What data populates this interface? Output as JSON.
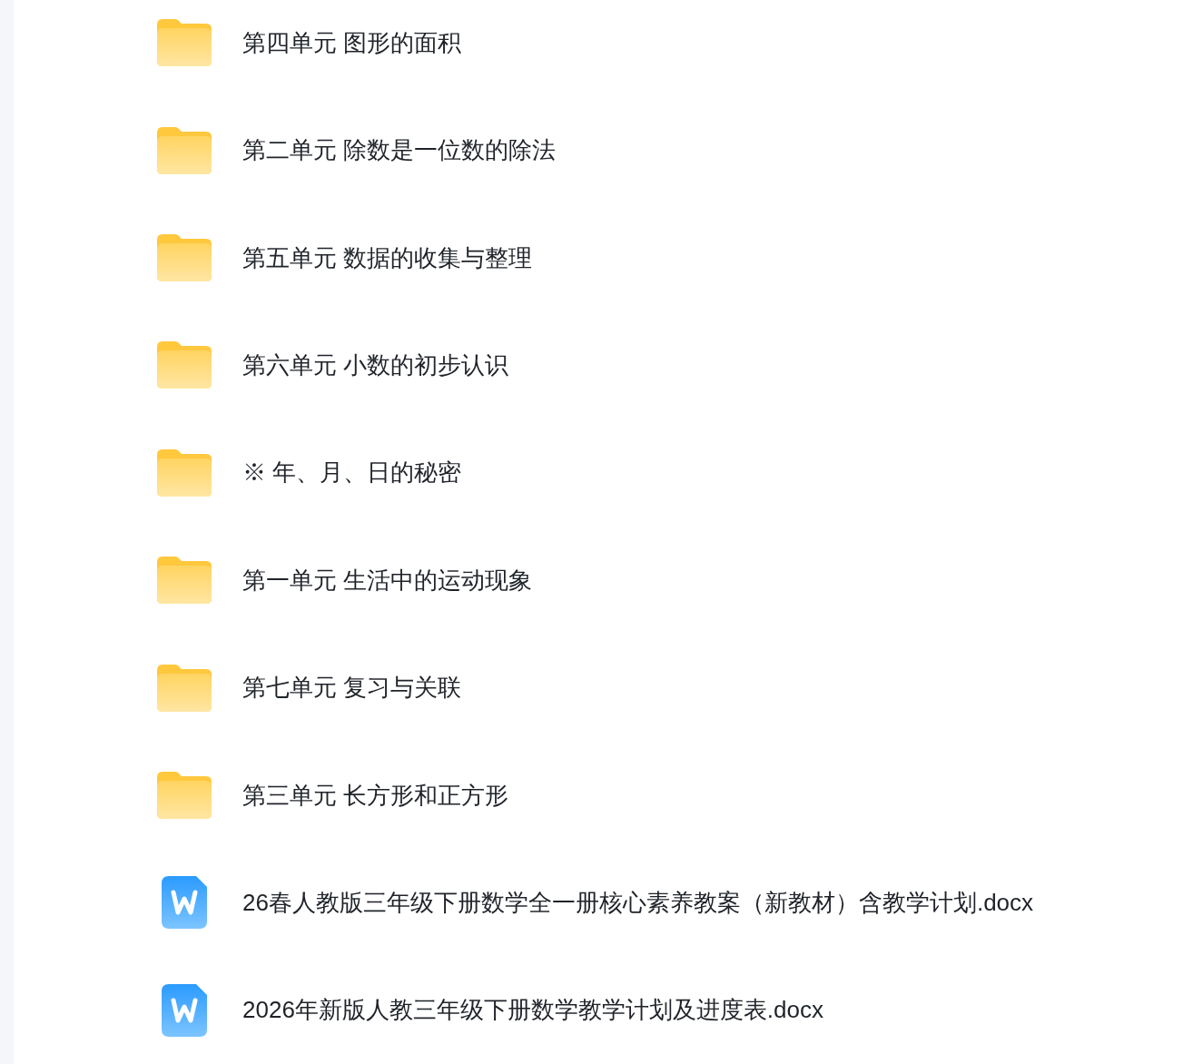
{
  "files": [
    {
      "kind": "folder",
      "name": "第四单元 图形的面积"
    },
    {
      "kind": "folder",
      "name": "第二单元 除数是一位数的除法"
    },
    {
      "kind": "folder",
      "name": "第五单元 数据的收集与整理"
    },
    {
      "kind": "folder",
      "name": "第六单元 小数的初步认识"
    },
    {
      "kind": "folder",
      "name": "※ 年、月、日的秘密"
    },
    {
      "kind": "folder",
      "name": "第一单元 生活中的运动现象"
    },
    {
      "kind": "folder",
      "name": "第七单元 复习与关联"
    },
    {
      "kind": "folder",
      "name": "第三单元 长方形和正方形"
    },
    {
      "kind": "word",
      "name": "26春人教版三年级下册数学全一册核心素养教案（新教材）含教学计划.docx"
    },
    {
      "kind": "word",
      "name": "2026年新版人教三年级下册数学教学计划及进度表.docx"
    }
  ]
}
